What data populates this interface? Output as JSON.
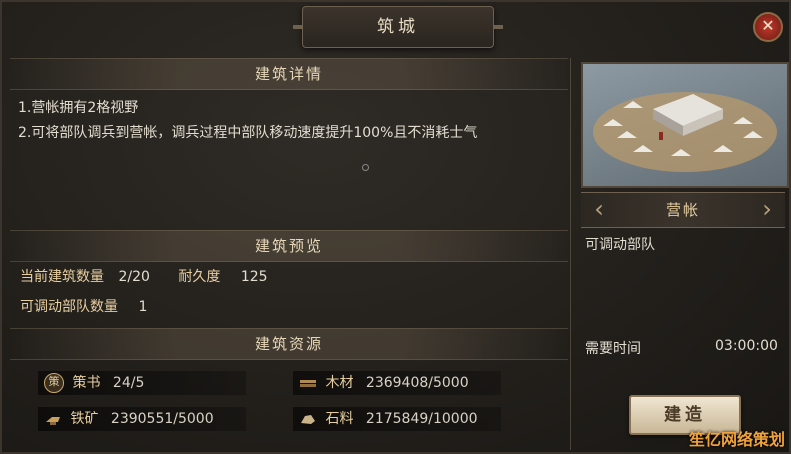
{
  "window": {
    "title": "筑城",
    "close_label": "✕"
  },
  "details": {
    "heading": "建筑详情",
    "lines": [
      "1.营帐拥有2格视野",
      "2.可将部队调兵到营帐，调兵过程中部队移动速度提升100%且不消耗士气"
    ]
  },
  "preview": {
    "heading": "建筑预览",
    "count_label": "当前建筑数量",
    "count_value": "2/20",
    "durability_label": "耐久度",
    "durability_value": "125",
    "troops_label": "可调动部队数量",
    "troops_value": "1"
  },
  "resources": {
    "heading": "建筑资源",
    "items": [
      {
        "icon": "strategy-book-icon",
        "badge": "策",
        "name": "策书",
        "value": "24/5"
      },
      {
        "icon": "wood-icon",
        "name": "木材",
        "value": "2369408/5000"
      },
      {
        "icon": "iron-ore-icon",
        "name": "铁矿",
        "value": "2390551/5000"
      },
      {
        "icon": "stone-icon",
        "name": "石料",
        "value": "2175849/10000"
      }
    ]
  },
  "building": {
    "name": "营帐",
    "effect": "可调动部队",
    "time_label": "需要时间",
    "time_value": "03:00:00",
    "build_label": "建造",
    "prev_label": "‹",
    "next_label": "›"
  },
  "watermark": "笙亿网络策划",
  "colors": {
    "accent": "#e8cfa0",
    "close": "#c0392b",
    "button": "#e6dac2"
  }
}
